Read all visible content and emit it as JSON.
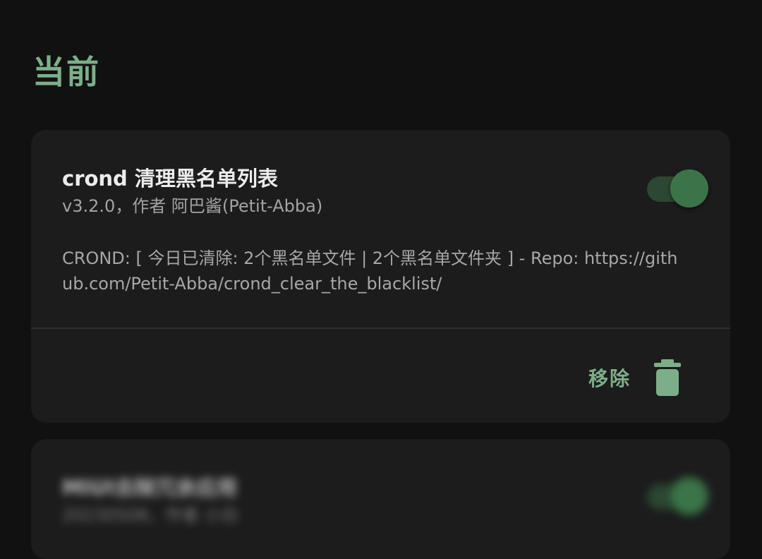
{
  "section": {
    "title": "当前"
  },
  "modules": [
    {
      "name": "crond 清理黑名单列表",
      "meta": "v3.2.0，作者 阿巴酱(Petit-Abba)",
      "description": "CROND: [ 今日已清除: 2个黑名单文件 | 2个黑名单文件夹 ] - Repo: https://github.com/Petit-Abba/crond_clear_the_blacklist/",
      "enabled": true,
      "remove_label": "移除",
      "toggle_icon": "toggle-switch",
      "remove_icon": "trash-icon"
    },
    {
      "name": "MIUI去除冗余应用",
      "meta": "20230508，作者 小白",
      "enabled": true,
      "blurred": true
    }
  ],
  "colors": {
    "background": "#111111",
    "card": "#1c1c1c",
    "accent": "#7cae8a",
    "toggle_thumb": "#3a7448",
    "toggle_track": "#2c4733"
  }
}
